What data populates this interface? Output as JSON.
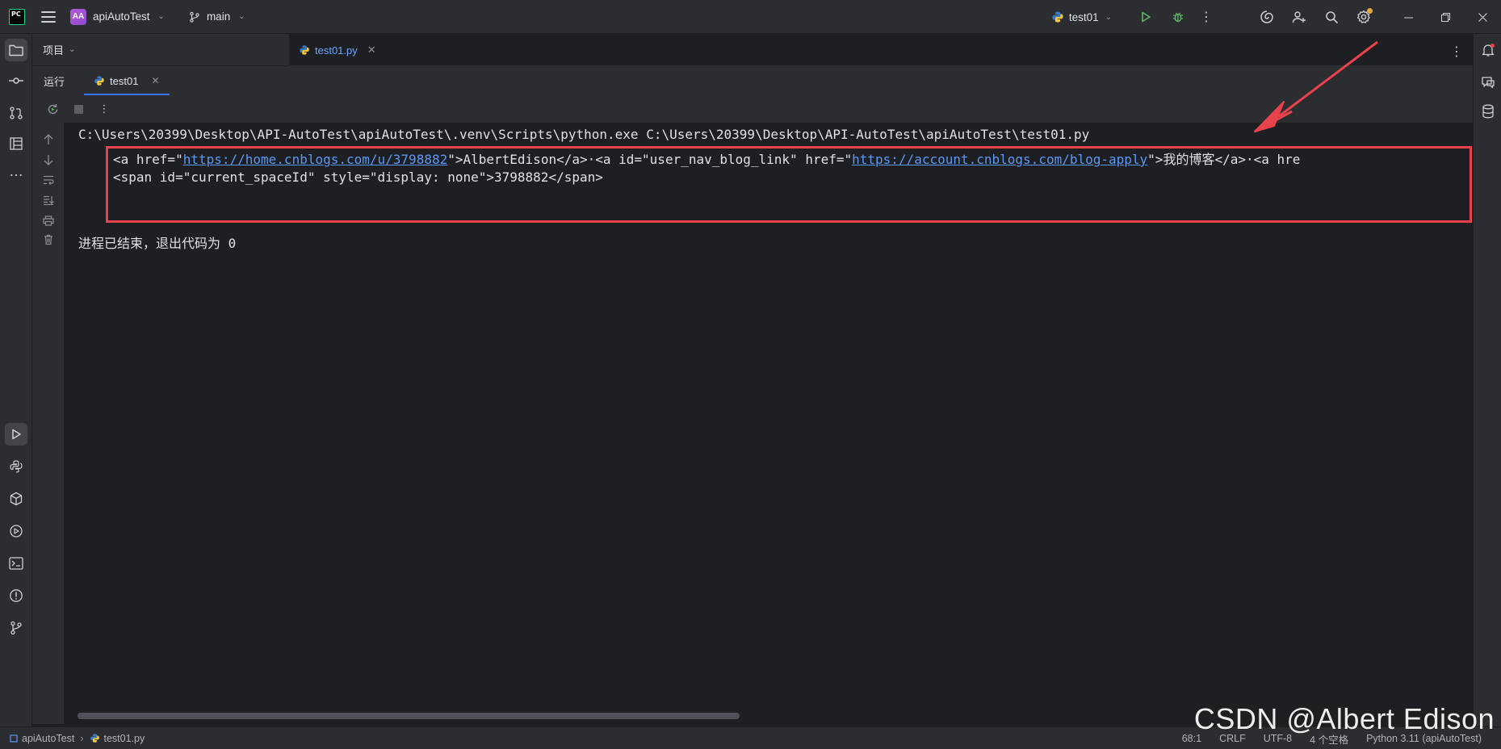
{
  "titlebar": {
    "app_logo": "PC",
    "project_badge": "AA",
    "project_name": "apiAutoTest",
    "branch_name": "main",
    "run_config_name": "test01"
  },
  "project_panel": {
    "label": "项目"
  },
  "editor": {
    "tab_name": "test01.py"
  },
  "run_window": {
    "title": "运行",
    "tab_name": "test01"
  },
  "console": {
    "command_line": "C:\\Users\\20399\\Desktop\\API-AutoTest\\apiAutoTest\\.venv\\Scripts\\python.exe C:\\Users\\20399\\Desktop\\API-AutoTest\\apiAutoTest\\test01.py",
    "output_line1": {
      "part1": "<a href=\"",
      "link1": "https://home.cnblogs.com/u/3798882",
      "part2": "\">AlbertEdison</a>·<a id=\"user_nav_blog_link\" href=\"",
      "link2": "https://account.cnblogs.com/blog-apply",
      "part3": "\">我的博客</a>·<a hre"
    },
    "output_line2": "<span id=\"current_spaceId\" style=\"display: none\">3798882</span>",
    "exit_message": "进程已结束，退出代码为 0"
  },
  "statusbar": {
    "crumb_project": "apiAutoTest",
    "crumb_file": "test01.py",
    "position": "68:1",
    "line_separator": "CRLF",
    "encoding": "UTF-8",
    "indent": "4 个空格",
    "interpreter": "Python 3.11 (apiAutoTest)"
  },
  "watermark": "CSDN @Albert Edison",
  "colors": {
    "accent": "#3574f0",
    "highlight_border": "#e8424c",
    "link": "#5c98f5",
    "run_green": "#5fb865"
  }
}
